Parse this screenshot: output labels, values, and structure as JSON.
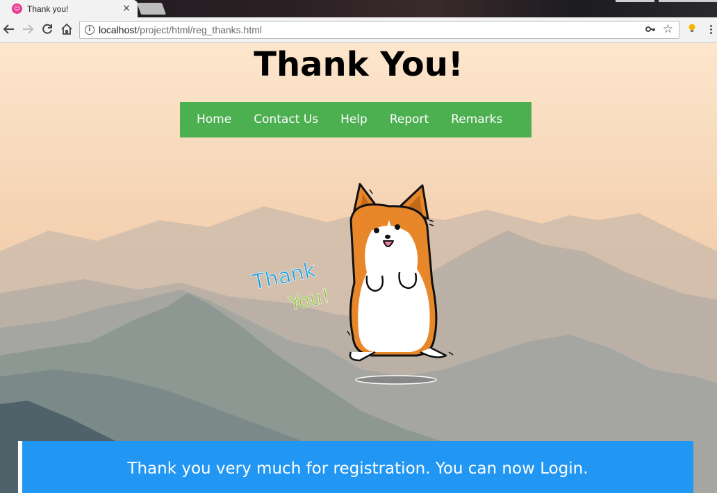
{
  "browser": {
    "tab": {
      "title": "Thank you!",
      "favicon_icon": "app-favicon",
      "close": "×"
    },
    "address": {
      "host": "localhost",
      "path": "/project/html/reg_thanks.html"
    }
  },
  "page": {
    "title": "Thank You!",
    "nav": [
      {
        "label": "Home"
      },
      {
        "label": "Contact Us"
      },
      {
        "label": "Help"
      },
      {
        "label": "Report"
      },
      {
        "label": "Remarks"
      }
    ],
    "illustration": {
      "thank_text": "Thank",
      "you_text": "You!"
    },
    "message": "Thank you very much for registration. You can now Login."
  },
  "colors": {
    "nav_bg": "#4caf50",
    "message_bg": "#2196f3",
    "thank_text": "#1e9fe0",
    "you_text": "#8cc63f",
    "corgi_orange": "#e8862a"
  }
}
